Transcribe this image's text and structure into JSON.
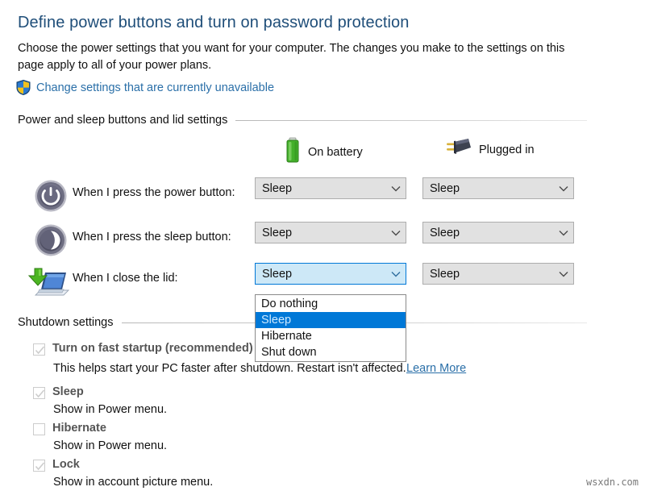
{
  "page": {
    "title": "Define power buttons and turn on password protection",
    "intro": "Choose the power settings that you want for your computer. The changes you make to the settings on this page apply to all of your power plans.",
    "uac_link": "Change settings that are currently unavailable",
    "uac_icon": "shield-icon",
    "watermark": "wsxdn.com"
  },
  "colors": {
    "heading": "#1f4e79",
    "link": "#2a6fa8",
    "accent_selection": "#0078d7",
    "combo_fill": "#e1e1e1",
    "combo_focus_fill": "#cde8f7",
    "battery_green": "#43b02a"
  },
  "power_section": {
    "label": "Power and sleep buttons and lid settings",
    "columns": [
      {
        "label": "On battery",
        "icon": "battery-icon"
      },
      {
        "label": "Plugged in",
        "icon": "power-plug-icon"
      }
    ],
    "rows": [
      {
        "icon": "power-button-icon",
        "label": "When I press the power button:",
        "on_battery": "Sleep",
        "plugged_in": "Sleep",
        "on_battery_focused": false
      },
      {
        "icon": "sleep-button-icon",
        "label": "When I press the sleep button:",
        "on_battery": "Sleep",
        "plugged_in": "Sleep",
        "on_battery_focused": false
      },
      {
        "icon": "laptop-close-lid-icon",
        "label": "When I close the lid:",
        "on_battery": "Sleep",
        "plugged_in": "Sleep",
        "on_battery_focused": true
      }
    ],
    "open_dropdown": {
      "belongs_to_row": "When I close the lid:",
      "column": "On battery",
      "options": [
        "Do nothing",
        "Sleep",
        "Hibernate",
        "Shut down"
      ],
      "selected": "Sleep"
    }
  },
  "shutdown_section": {
    "label": "Shutdown settings",
    "options": [
      {
        "title": "Turn on fast startup (recommended)",
        "checked": true,
        "disabled": true,
        "description": "This helps start your PC faster after shutdown. Restart isn't affected.",
        "link": "Learn More"
      },
      {
        "title": "Sleep",
        "checked": true,
        "disabled": true,
        "description": "Show in Power menu."
      },
      {
        "title": "Hibernate",
        "checked": false,
        "disabled": true,
        "description": "Show in Power menu."
      },
      {
        "title": "Lock",
        "checked": true,
        "disabled": true,
        "description": "Show in account picture menu."
      }
    ]
  }
}
